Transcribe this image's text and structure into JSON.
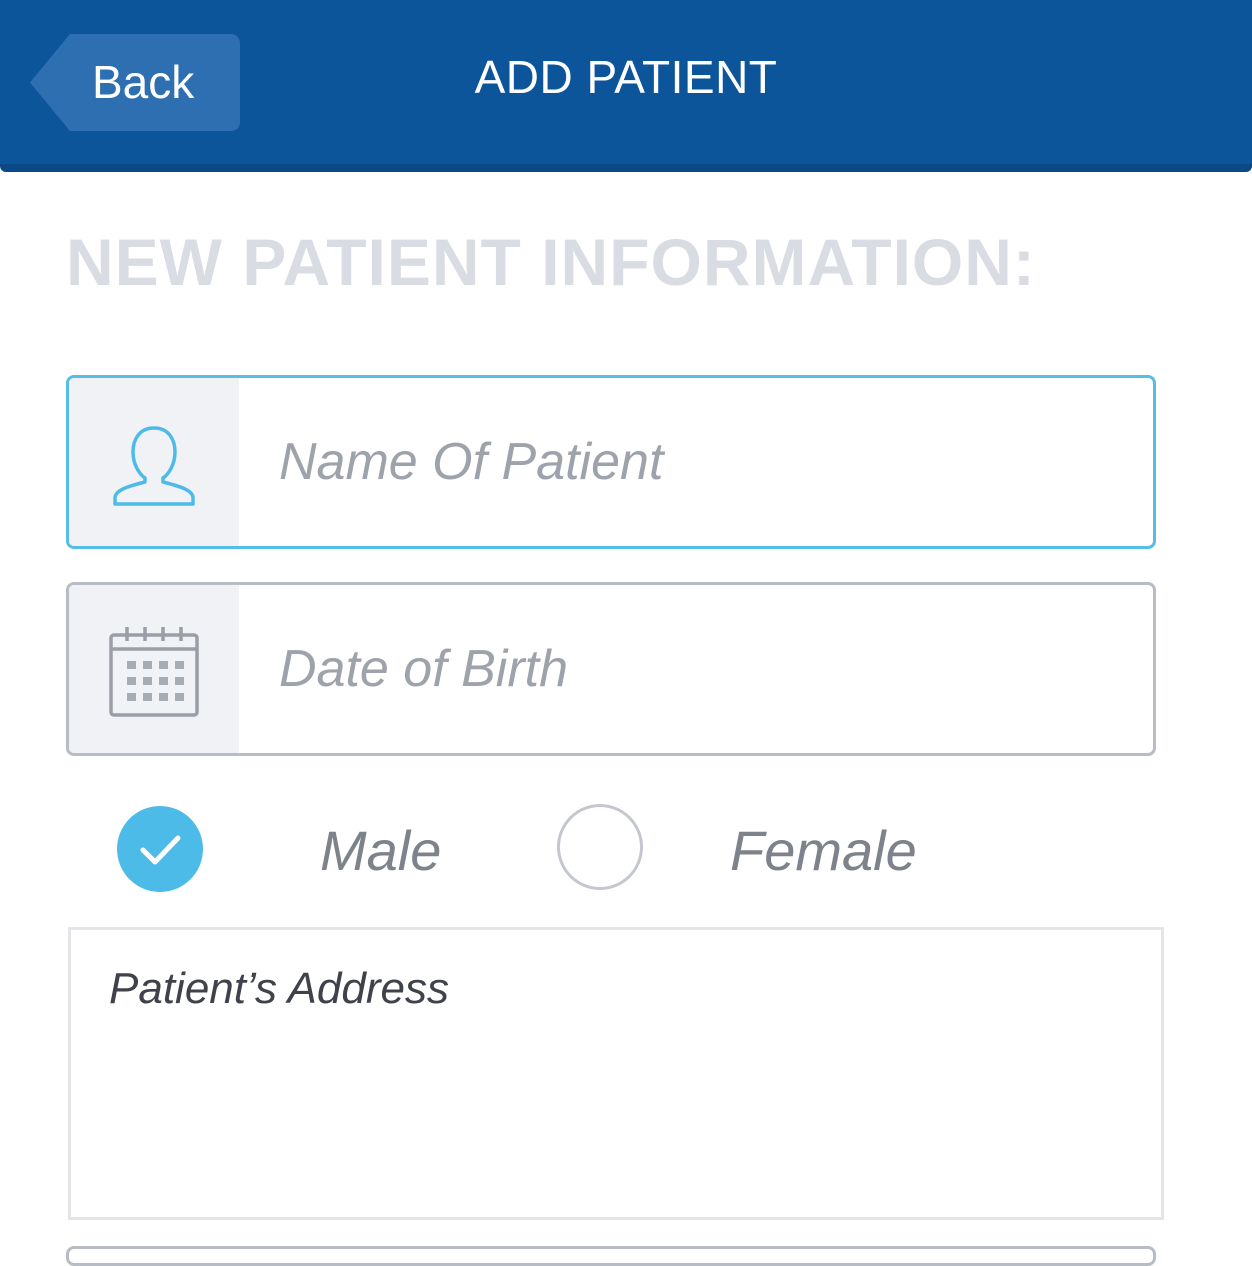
{
  "header": {
    "back_label": "Back",
    "title": "ADD PATIENT",
    "background_color": "#0d559b"
  },
  "form": {
    "section_heading": "NEW PATIENT INFORMATION:",
    "name_field": {
      "placeholder": "Name Of Patient",
      "value": "",
      "icon": "user-icon",
      "focused": true
    },
    "dob_field": {
      "placeholder": "Date of Birth",
      "value": "",
      "icon": "calendar-icon"
    },
    "gender": {
      "options": [
        {
          "label": "Male",
          "checked": true
        },
        {
          "label": "Female",
          "checked": false
        }
      ]
    },
    "address_field": {
      "placeholder": "Patient’s Address",
      "value": ""
    }
  },
  "colors": {
    "accent": "#4dbbe8",
    "focus_border": "#55bde6",
    "border": "#b8bcc4",
    "heading": "#d9dce3"
  }
}
